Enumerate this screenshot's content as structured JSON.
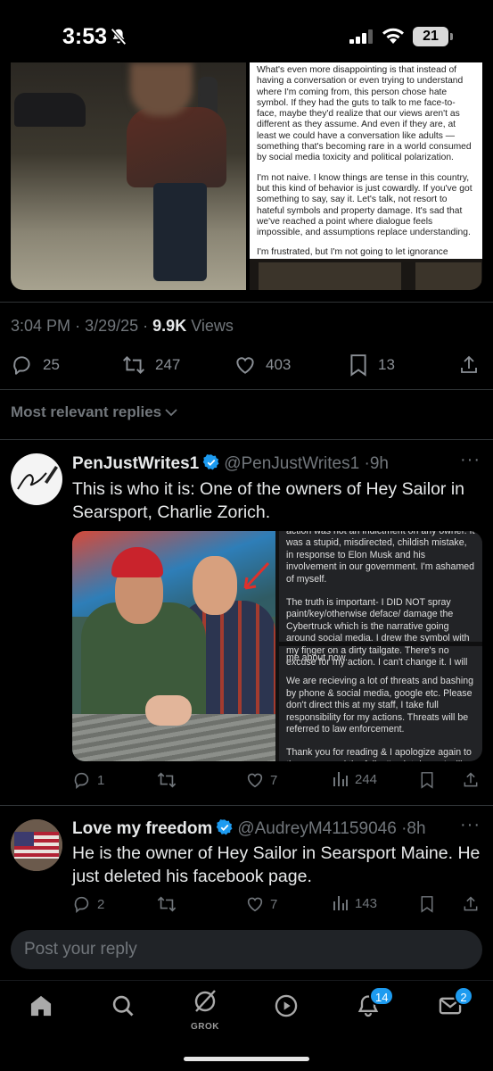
{
  "status_bar": {
    "time": "3:53",
    "battery": "21"
  },
  "tweet": {
    "media_text_paragraphs": [
      "What's even more disappointing is that instead of having a conversation or even trying to understand where I'm coming from, this person chose hate symbol. If they had the guts to talk to me face-to-face, maybe they'd realize that our views aren't as different as they assume. And even if they are, at least we could have a conversation like adults — something that's becoming rare in a world consumed by social media toxicity and political polarization.",
      "I'm not naive. I know things are tense in this country, but this kind of behavior is just cowardly. If you've got something to say, say it. Let's talk, not resort to hateful symbols and property damage. It's sad that we've reached a point where dialogue feels impossible, and assumptions replace understanding.",
      "I'm frustrated, but I'm not going to let ignorance dictate how I move through the world. I just wish others would have the courage to do the same."
    ],
    "time": "3:04 PM",
    "sep": "·",
    "date": "3/29/25",
    "views_count": "9.9K",
    "views_label": "Views",
    "replies": "25",
    "reposts": "247",
    "likes": "403",
    "bookmarks": "13"
  },
  "replies_header": "Most relevant replies",
  "replies": [
    {
      "name": "PenJustWrites1",
      "handle": "@PenJustWrites1",
      "age": "9h",
      "text": "This is who it is: One of the owners of Hey Sailor in Searsport, Charlie Zorich.",
      "media_text_top": [
        "action was not an indictment on any owner. It was a stupid, misdirected, childish mistake, in response to Elon Musk and his involvement in our government. I'm ashamed of myself.",
        "The truth is important- I DID NOT spray paint/key/otherwise deface/ damage the Cybertruck which is the narrative going around social media. I drew the symbol with my finger on a dirty tailgate. There's no excuse for my action. I can't change it. I will"
      ],
      "media_text_bottom": [
        "me about now.",
        "We are recieving a lot of threats and bashing by phone & social media, google etc. Please don't direct this at my staff, I take full responsibility for my actions. Threats will be referred to law enforcement.",
        "Thank you for reading & I apologize again to the owner and the folks I've let down. I will do"
      ],
      "replies": "1",
      "reposts": "",
      "likes": "7",
      "views": "244"
    },
    {
      "name": "Love my freedom",
      "handle": "@AudreyM41159046",
      "age": "8h",
      "text": "He is the owner of Hey Sailor in Searsport Maine. He just deleted his facebook page.",
      "replies": "2",
      "reposts": "",
      "likes": "7",
      "views": "143"
    }
  ],
  "reply_input": {
    "placeholder": "Post your reply"
  },
  "tabbar": {
    "grok_label": "GROK",
    "notifications_badge": "14",
    "messages_badge": "2"
  },
  "colors": {
    "accent": "#1d9bf0",
    "muted": "#71767b",
    "text": "#e7e9ea"
  }
}
